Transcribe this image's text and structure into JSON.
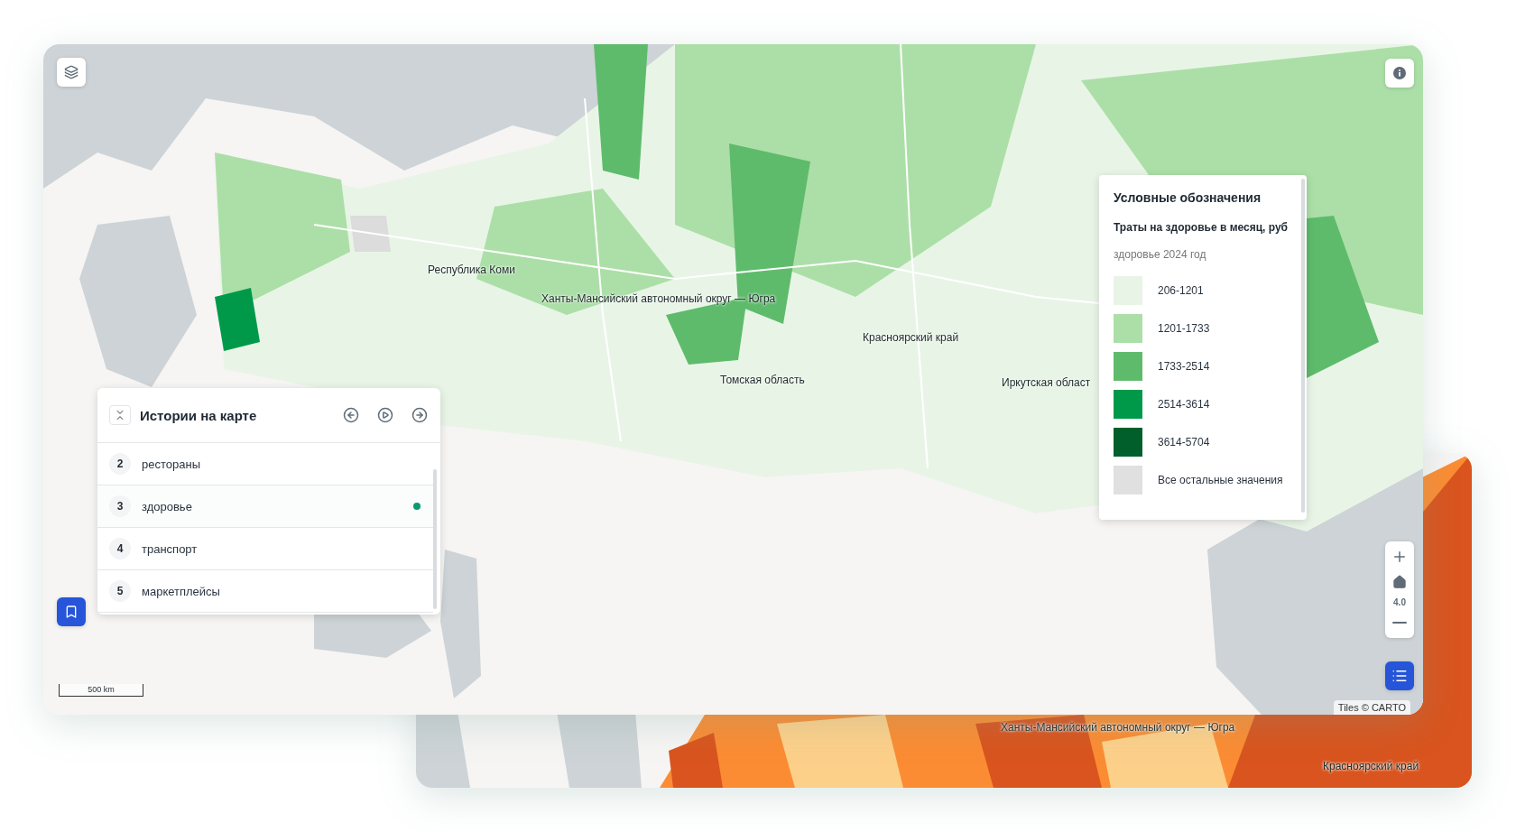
{
  "back_map": {
    "region_labels": [
      "Ханты-Мансийский автономный округ — Югра",
      "Красноярский край"
    ]
  },
  "main_map": {
    "region_labels": [
      "Республика Коми",
      "Ханты-Мансийский автономный округ — Югра",
      "Красноярский край",
      "Томская область",
      "Иркутская област"
    ],
    "scale": "500 km",
    "attribution": "Tiles © CARTO",
    "zoom_level": "4.0"
  },
  "stories": {
    "title": "Истории на карте",
    "items": [
      {
        "number": "2",
        "label": "рестораны",
        "selected": false
      },
      {
        "number": "3",
        "label": "здоровье",
        "selected": true
      },
      {
        "number": "4",
        "label": "транспорт",
        "selected": false
      },
      {
        "number": "5",
        "label": "маркетплейсы",
        "selected": false
      }
    ]
  },
  "legend": {
    "title": "Условные обозначения",
    "subtitle": "Траты на здоровье в месяц, руб",
    "caption": "здоровье 2024 год",
    "items": [
      {
        "label": "206-1201",
        "color": "#e8f5e6"
      },
      {
        "label": "1201-1733",
        "color": "#acdfa7"
      },
      {
        "label": "1733-2514",
        "color": "#5fbb6c"
      },
      {
        "label": "2514-3614",
        "color": "#00994a"
      },
      {
        "label": "3614-5704",
        "color": "#005f2a"
      },
      {
        "label": "Все остальные значения",
        "color": "#e0e0e0"
      }
    ]
  }
}
